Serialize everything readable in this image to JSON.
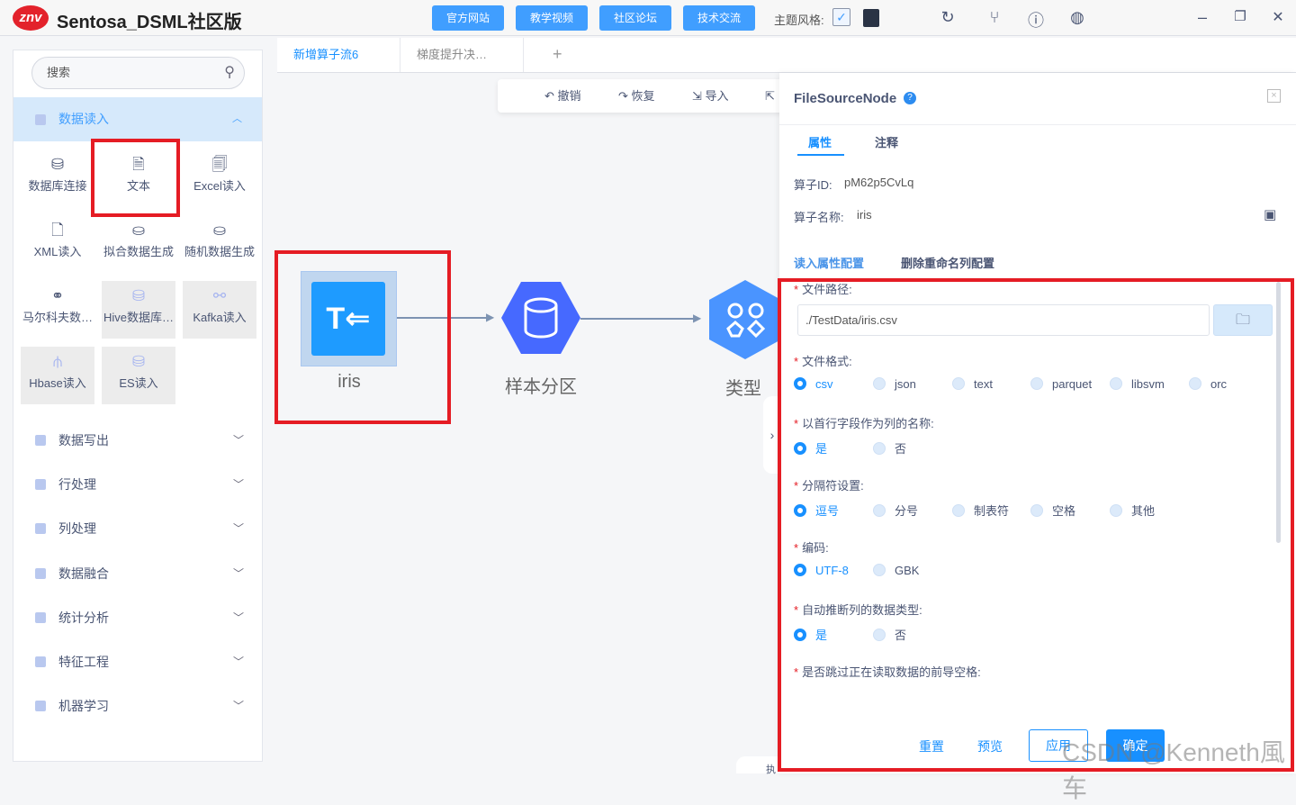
{
  "app": {
    "logo": "znv",
    "title": "Sentosa_DSML社区版"
  },
  "topbar": {
    "buttons": [
      "官方网站",
      "教学视频",
      "社区论坛",
      "技术交流"
    ],
    "theme_label": "主题风格:",
    "icons": [
      "refresh-icon",
      "branch-icon",
      "help-icon",
      "globe-icon"
    ],
    "window": [
      "minimize-icon",
      "restore-icon",
      "close-icon"
    ]
  },
  "sidebar": {
    "search_placeholder": "搜索",
    "open_section": "数据读入",
    "items": [
      {
        "label": "数据库连接",
        "icon": "database-link-icon",
        "disabled": false
      },
      {
        "label": "文本",
        "icon": "text-file-icon",
        "disabled": false
      },
      {
        "label": "Excel读入",
        "icon": "excel-icon",
        "disabled": false
      },
      {
        "label": "XML读入",
        "icon": "xml-icon",
        "disabled": false
      },
      {
        "label": "拟合数据生成",
        "icon": "fit-data-icon",
        "disabled": false
      },
      {
        "label": "随机数据生成",
        "icon": "random-data-icon",
        "disabled": false
      },
      {
        "label": "马尔科夫数…",
        "icon": "markov-icon",
        "disabled": false
      },
      {
        "label": "Hive数据库…",
        "icon": "hive-icon",
        "disabled": true
      },
      {
        "label": "Kafka读入",
        "icon": "kafka-icon",
        "disabled": true
      },
      {
        "label": "Hbase读入",
        "icon": "hbase-icon",
        "disabled": true
      },
      {
        "label": "ES读入",
        "icon": "es-icon",
        "disabled": true
      }
    ],
    "categories": [
      "数据写出",
      "行处理",
      "列处理",
      "数据融合",
      "统计分析",
      "特征工程",
      "机器学习"
    ]
  },
  "tabs": [
    {
      "label": "新增算子流6",
      "active": true
    },
    {
      "label": "梯度提升决…",
      "active": false
    }
  ],
  "toolbar": {
    "undo": "撤销",
    "redo": "恢复",
    "import": "导入"
  },
  "canvas": {
    "nodes": [
      {
        "label": "iris"
      },
      {
        "label": "样本分区"
      },
      {
        "label": "类型"
      }
    ],
    "bottom_tab": "执"
  },
  "panel": {
    "title": "FileSourceNode",
    "tabs": [
      "属性",
      "注释"
    ],
    "id_label": "算子ID:",
    "id_value": "pM62p5CvLq",
    "name_label": "算子名称:",
    "name_value": "iris",
    "subtabs": [
      "读入属性配置",
      "删除重命名列配置"
    ],
    "file_path_label": "文件路径:",
    "file_path_value": "./TestData/iris.csv",
    "groups": [
      {
        "label": "文件格式:",
        "options": [
          "csv",
          "json",
          "text",
          "parquet",
          "libsvm",
          "orc"
        ],
        "selected": 0
      },
      {
        "label": "以首行字段作为列的名称:",
        "options": [
          "是",
          "否"
        ],
        "selected": 0
      },
      {
        "label": "分隔符设置:",
        "options": [
          "逗号",
          "分号",
          "制表符",
          "空格",
          "其他"
        ],
        "selected": 0
      },
      {
        "label": "编码:",
        "options": [
          "UTF-8",
          "GBK"
        ],
        "selected": 0
      },
      {
        "label": "自动推断列的数据类型:",
        "options": [
          "是",
          "否"
        ],
        "selected": 0
      }
    ],
    "skip_label": "是否跳过正在读取数据的前导空格:",
    "buttons": {
      "reset": "重置",
      "preview": "预览",
      "apply": "应用",
      "confirm": "确定"
    }
  },
  "watermark": "CSDN @Kenneth風车",
  "colors": {
    "accent": "#409eff",
    "primary": "#1890ff",
    "annotation": "#e51c24",
    "node_blue": "#1e9bff",
    "node_indigo": "#4669ff"
  }
}
